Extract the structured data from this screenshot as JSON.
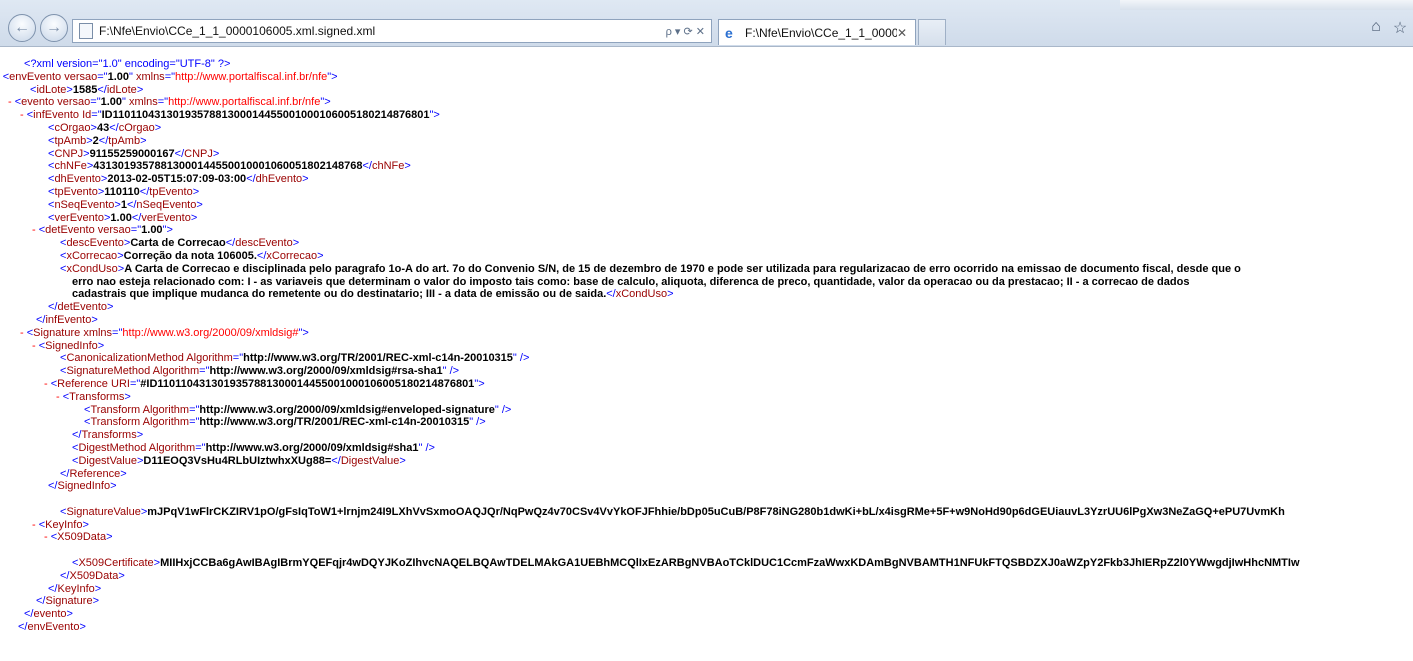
{
  "browser": {
    "address_url": "F:\\Nfe\\Envio\\CCe_1_1_0000106005.xml.signed.xml",
    "tab_title": "F:\\Nfe\\Envio\\CCe_1_1_0000...",
    "addr_controls": "ρ ▾ ⟳ ✕"
  },
  "xml_lines": [
    {
      "indent": 3,
      "minus": false,
      "parts": [
        [
          "pi",
          "<?xml version=\"1.0\" encoding=\"UTF-8\" ?>"
        ]
      ]
    },
    {
      "indent": 0,
      "minus": true,
      "parts": [
        [
          "b",
          "<"
        ],
        [
          "t",
          "envEvento"
        ],
        [
          "t",
          " versao"
        ],
        [
          "b",
          "=\""
        ],
        [
          "txt",
          "1.00"
        ],
        [
          "b",
          "\""
        ],
        [
          "t",
          " xmlns"
        ],
        [
          "b",
          "=\""
        ],
        [
          "m",
          "http://www.portalfiscal.inf.br/nfe"
        ],
        [
          "b",
          "\">"
        ]
      ]
    },
    {
      "indent": 4,
      "minus": false,
      "parts": [
        [
          "b",
          "<"
        ],
        [
          "t",
          "idLote"
        ],
        [
          "b",
          ">"
        ],
        [
          "txt",
          "1585"
        ],
        [
          "b",
          "</"
        ],
        [
          "t",
          "idLote"
        ],
        [
          "b",
          ">"
        ]
      ]
    },
    {
      "indent": 2,
      "minus": true,
      "parts": [
        [
          "b",
          "<"
        ],
        [
          "t",
          "evento"
        ],
        [
          "t",
          " versao"
        ],
        [
          "b",
          "=\""
        ],
        [
          "txt",
          "1.00"
        ],
        [
          "b",
          "\""
        ],
        [
          "t",
          " xmlns"
        ],
        [
          "b",
          "=\""
        ],
        [
          "m",
          "http://www.portalfiscal.inf.br/nfe"
        ],
        [
          "b",
          "\">"
        ]
      ]
    },
    {
      "indent": 4,
      "minus": true,
      "parts": [
        [
          "b",
          "<"
        ],
        [
          "t",
          "infEvento"
        ],
        [
          "t",
          " Id"
        ],
        [
          "b",
          "=\""
        ],
        [
          "txt",
          "ID1101104313019357881300014455001000106005180214876801"
        ],
        [
          "b",
          "\">"
        ]
      ]
    },
    {
      "indent": 7,
      "minus": false,
      "parts": [
        [
          "b",
          "<"
        ],
        [
          "t",
          "cOrgao"
        ],
        [
          "b",
          ">"
        ],
        [
          "txt",
          "43"
        ],
        [
          "b",
          "</"
        ],
        [
          "t",
          "cOrgao"
        ],
        [
          "b",
          ">"
        ]
      ]
    },
    {
      "indent": 7,
      "minus": false,
      "parts": [
        [
          "b",
          "<"
        ],
        [
          "t",
          "tpAmb"
        ],
        [
          "b",
          ">"
        ],
        [
          "txt",
          "2"
        ],
        [
          "b",
          "</"
        ],
        [
          "t",
          "tpAmb"
        ],
        [
          "b",
          ">"
        ]
      ]
    },
    {
      "indent": 7,
      "minus": false,
      "parts": [
        [
          "b",
          "<"
        ],
        [
          "t",
          "CNPJ"
        ],
        [
          "b",
          ">"
        ],
        [
          "txt",
          "91155259000167"
        ],
        [
          "b",
          "</"
        ],
        [
          "t",
          "CNPJ"
        ],
        [
          "b",
          ">"
        ]
      ]
    },
    {
      "indent": 7,
      "minus": false,
      "parts": [
        [
          "b",
          "<"
        ],
        [
          "t",
          "chNFe"
        ],
        [
          "b",
          ">"
        ],
        [
          "txt",
          "43130193578813000144550010001060051802148768"
        ],
        [
          "b",
          "</"
        ],
        [
          "t",
          "chNFe"
        ],
        [
          "b",
          ">"
        ]
      ]
    },
    {
      "indent": 7,
      "minus": false,
      "parts": [
        [
          "b",
          "<"
        ],
        [
          "t",
          "dhEvento"
        ],
        [
          "b",
          ">"
        ],
        [
          "txt",
          "2013-02-05T15:07:09-03:00"
        ],
        [
          "b",
          "</"
        ],
        [
          "t",
          "dhEvento"
        ],
        [
          "b",
          ">"
        ]
      ]
    },
    {
      "indent": 7,
      "minus": false,
      "parts": [
        [
          "b",
          "<"
        ],
        [
          "t",
          "tpEvento"
        ],
        [
          "b",
          ">"
        ],
        [
          "txt",
          "110110"
        ],
        [
          "b",
          "</"
        ],
        [
          "t",
          "tpEvento"
        ],
        [
          "b",
          ">"
        ]
      ]
    },
    {
      "indent": 7,
      "minus": false,
      "parts": [
        [
          "b",
          "<"
        ],
        [
          "t",
          "nSeqEvento"
        ],
        [
          "b",
          ">"
        ],
        [
          "txt",
          "1"
        ],
        [
          "b",
          "</"
        ],
        [
          "t",
          "nSeqEvento"
        ],
        [
          "b",
          ">"
        ]
      ]
    },
    {
      "indent": 7,
      "minus": false,
      "parts": [
        [
          "b",
          "<"
        ],
        [
          "t",
          "verEvento"
        ],
        [
          "b",
          ">"
        ],
        [
          "txt",
          "1.00"
        ],
        [
          "b",
          "</"
        ],
        [
          "t",
          "verEvento"
        ],
        [
          "b",
          ">"
        ]
      ]
    },
    {
      "indent": 6,
      "minus": true,
      "parts": [
        [
          "b",
          "<"
        ],
        [
          "t",
          "detEvento"
        ],
        [
          "t",
          " versao"
        ],
        [
          "b",
          "=\""
        ],
        [
          "txt",
          "1.00"
        ],
        [
          "b",
          "\">"
        ]
      ]
    },
    {
      "indent": 9,
      "minus": false,
      "parts": [
        [
          "b",
          "<"
        ],
        [
          "t",
          "descEvento"
        ],
        [
          "b",
          ">"
        ],
        [
          "txt",
          "Carta de Correcao"
        ],
        [
          "b",
          "</"
        ],
        [
          "t",
          "descEvento"
        ],
        [
          "b",
          ">"
        ]
      ]
    },
    {
      "indent": 9,
      "minus": false,
      "parts": [
        [
          "b",
          "<"
        ],
        [
          "t",
          "xCorrecao"
        ],
        [
          "b",
          ">"
        ],
        [
          "txt",
          "Correção da nota 106005."
        ],
        [
          "b",
          "</"
        ],
        [
          "t",
          "xCorrecao"
        ],
        [
          "b",
          ">"
        ]
      ]
    },
    {
      "indent": 9,
      "minus": false,
      "parts": [
        [
          "b",
          "<"
        ],
        [
          "t",
          "xCondUso"
        ],
        [
          "b",
          ">"
        ],
        [
          "txt",
          "A Carta de Correcao e disciplinada pelo paragrafo 1o-A do art. 7o do Convenio S/N, de 15 de dezembro de 1970 e pode ser utilizada para regularizacao de erro ocorrido na emissao de documento fiscal, desde que o"
        ]
      ]
    },
    {
      "indent": 11,
      "minus": false,
      "parts": [
        [
          "txt",
          "erro nao esteja relacionado com: I - as variaveis que determinam o valor do imposto tais como: base de calculo, aliquota, diferenca de preco, quantidade, valor da operacao ou da prestacao; II - a correcao de dados"
        ]
      ]
    },
    {
      "indent": 11,
      "minus": false,
      "parts": [
        [
          "txt",
          "cadastrais que implique mudanca do remetente ou do destinatario; III - a data de emissão ou de saida."
        ],
        [
          "b",
          "</"
        ],
        [
          "t",
          "xCondUso"
        ],
        [
          "b",
          ">"
        ]
      ]
    },
    {
      "indent": 7,
      "minus": false,
      "parts": [
        [
          "b",
          "</"
        ],
        [
          "t",
          "detEvento"
        ],
        [
          "b",
          ">"
        ]
      ]
    },
    {
      "indent": 5,
      "minus": false,
      "parts": [
        [
          "b",
          "</"
        ],
        [
          "t",
          "infEvento"
        ],
        [
          "b",
          ">"
        ]
      ]
    },
    {
      "indent": 4,
      "minus": true,
      "parts": [
        [
          "b",
          "<"
        ],
        [
          "t",
          "Signature"
        ],
        [
          "t",
          " xmlns"
        ],
        [
          "b",
          "=\""
        ],
        [
          "m",
          "http://www.w3.org/2000/09/xmldsig#"
        ],
        [
          "b",
          "\">"
        ]
      ]
    },
    {
      "indent": 6,
      "minus": true,
      "parts": [
        [
          "b",
          "<"
        ],
        [
          "t",
          "SignedInfo"
        ],
        [
          "b",
          ">"
        ]
      ]
    },
    {
      "indent": 9,
      "minus": false,
      "parts": [
        [
          "b",
          "<"
        ],
        [
          "t",
          "CanonicalizationMethod"
        ],
        [
          "t",
          " Algorithm"
        ],
        [
          "b",
          "=\""
        ],
        [
          "txt",
          "http://www.w3.org/TR/2001/REC-xml-c14n-20010315"
        ],
        [
          "b",
          "\" />"
        ]
      ]
    },
    {
      "indent": 9,
      "minus": false,
      "parts": [
        [
          "b",
          "<"
        ],
        [
          "t",
          "SignatureMethod"
        ],
        [
          "t",
          " Algorithm"
        ],
        [
          "b",
          "=\""
        ],
        [
          "txt",
          "http://www.w3.org/2000/09/xmldsig#rsa-sha1"
        ],
        [
          "b",
          "\" />"
        ]
      ]
    },
    {
      "indent": 8,
      "minus": true,
      "parts": [
        [
          "b",
          "<"
        ],
        [
          "t",
          "Reference"
        ],
        [
          "t",
          " URI"
        ],
        [
          "b",
          "=\""
        ],
        [
          "txt",
          "#ID1101104313019357881300014455001000106005180214876801"
        ],
        [
          "b",
          "\">"
        ]
      ]
    },
    {
      "indent": 10,
      "minus": true,
      "parts": [
        [
          "b",
          "<"
        ],
        [
          "t",
          "Transforms"
        ],
        [
          "b",
          ">"
        ]
      ]
    },
    {
      "indent": 13,
      "minus": false,
      "parts": [
        [
          "b",
          "<"
        ],
        [
          "t",
          "Transform"
        ],
        [
          "t",
          " Algorithm"
        ],
        [
          "b",
          "=\""
        ],
        [
          "txt",
          "http://www.w3.org/2000/09/xmldsig#enveloped-signature"
        ],
        [
          "b",
          "\" />"
        ]
      ]
    },
    {
      "indent": 13,
      "minus": false,
      "parts": [
        [
          "b",
          "<"
        ],
        [
          "t",
          "Transform"
        ],
        [
          "t",
          " Algorithm"
        ],
        [
          "b",
          "=\""
        ],
        [
          "txt",
          "http://www.w3.org/TR/2001/REC-xml-c14n-20010315"
        ],
        [
          "b",
          "\" />"
        ]
      ]
    },
    {
      "indent": 11,
      "minus": false,
      "parts": [
        [
          "b",
          "</"
        ],
        [
          "t",
          "Transforms"
        ],
        [
          "b",
          ">"
        ]
      ]
    },
    {
      "indent": 11,
      "minus": false,
      "parts": [
        [
          "b",
          "<"
        ],
        [
          "t",
          "DigestMethod"
        ],
        [
          "t",
          " Algorithm"
        ],
        [
          "b",
          "=\""
        ],
        [
          "txt",
          "http://www.w3.org/2000/09/xmldsig#sha1"
        ],
        [
          "b",
          "\" />"
        ]
      ]
    },
    {
      "indent": 11,
      "minus": false,
      "parts": [
        [
          "b",
          "<"
        ],
        [
          "t",
          "DigestValue"
        ],
        [
          "b",
          ">"
        ],
        [
          "txt",
          "D11EOQ3VsHu4RLbUIztwhxXUg88="
        ],
        [
          "b",
          "</"
        ],
        [
          "t",
          "DigestValue"
        ],
        [
          "b",
          ">"
        ]
      ]
    },
    {
      "indent": 9,
      "minus": false,
      "parts": [
        [
          "b",
          "</"
        ],
        [
          "t",
          "Reference"
        ],
        [
          "b",
          ">"
        ]
      ]
    },
    {
      "indent": 7,
      "minus": false,
      "parts": [
        [
          "b",
          "</"
        ],
        [
          "t",
          "SignedInfo"
        ],
        [
          "b",
          ">"
        ]
      ]
    },
    {
      "indent": 0,
      "minus": false,
      "parts": []
    },
    {
      "indent": 9,
      "minus": false,
      "parts": [
        [
          "b",
          "<"
        ],
        [
          "t",
          "SignatureValue"
        ],
        [
          "b",
          ">"
        ],
        [
          "txt",
          "mJPqV1wFlrCKZIRV1pO/gFsIqToW1+lrnjm24I9LXhVvSxmoOAQJQr/NqPwQz4v70CSv4VvYkOFJFhhie/bDp05uCuB/P8F78iNG280b1dwKi+bL/x4isgRMe+5F+w9NoHd90p6dGEUiauvL3YzrUU6lPgXw3NeZaGQ+ePU7UvmKh"
        ]
      ]
    },
    {
      "indent": 6,
      "minus": true,
      "parts": [
        [
          "b",
          "<"
        ],
        [
          "t",
          "KeyInfo"
        ],
        [
          "b",
          ">"
        ]
      ]
    },
    {
      "indent": 8,
      "minus": true,
      "parts": [
        [
          "b",
          "<"
        ],
        [
          "t",
          "X509Data"
        ],
        [
          "b",
          ">"
        ]
      ]
    },
    {
      "indent": 0,
      "minus": false,
      "parts": []
    },
    {
      "indent": 11,
      "minus": false,
      "parts": [
        [
          "b",
          "<"
        ],
        [
          "t",
          "X509Certificate"
        ],
        [
          "b",
          ">"
        ],
        [
          "txt",
          "MIIHxjCCBa6gAwIBAgIBrmYQEFqjr4wDQYJKoZIhvcNAQELBQAwTDELMAkGA1UEBhMCQlIxEzARBgNVBAoTCklDUC1CcmFzaWwxKDAmBgNVBAMTH1NFUkFTQSBDZXJ0aWZpY2Fkb3JhIERpZ2l0YWwgdjIwHhcNMTIw"
        ]
      ]
    },
    {
      "indent": 9,
      "minus": false,
      "parts": [
        [
          "b",
          "</"
        ],
        [
          "t",
          "X509Data"
        ],
        [
          "b",
          ">"
        ]
      ]
    },
    {
      "indent": 7,
      "minus": false,
      "parts": [
        [
          "b",
          "</"
        ],
        [
          "t",
          "KeyInfo"
        ],
        [
          "b",
          ">"
        ]
      ]
    },
    {
      "indent": 5,
      "minus": false,
      "parts": [
        [
          "b",
          "</"
        ],
        [
          "t",
          "Signature"
        ],
        [
          "b",
          ">"
        ]
      ]
    },
    {
      "indent": 3,
      "minus": false,
      "parts": [
        [
          "b",
          "</"
        ],
        [
          "t",
          "evento"
        ],
        [
          "b",
          ">"
        ]
      ]
    },
    {
      "indent": 2,
      "minus": false,
      "parts": [
        [
          "b",
          "</"
        ],
        [
          "t",
          "envEvento"
        ],
        [
          "b",
          ">"
        ]
      ]
    }
  ]
}
